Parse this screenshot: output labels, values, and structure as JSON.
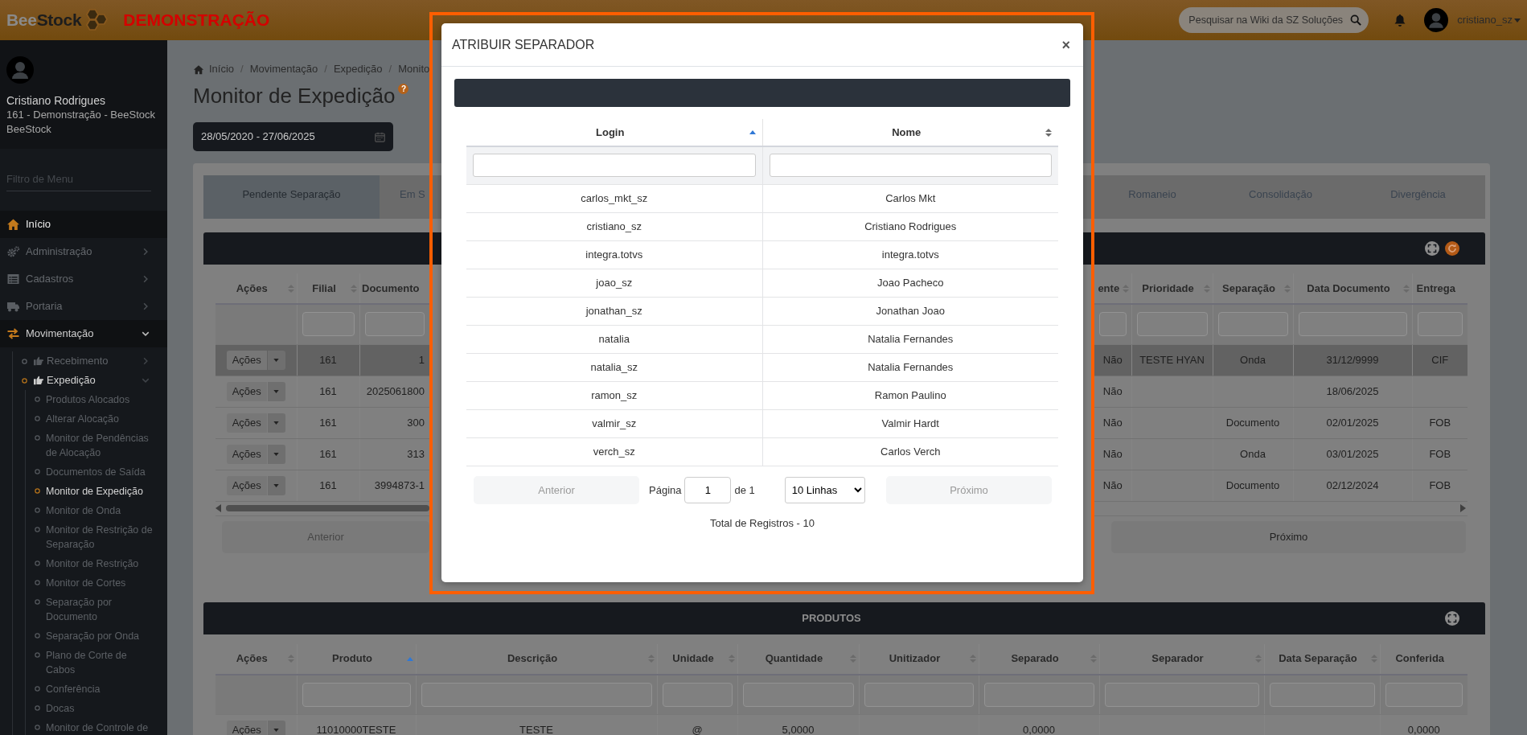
{
  "header": {
    "logo_prefix": "Bee",
    "logo_suffix": "Stock",
    "environment": "DEMONSTRAÇÃO",
    "search": {
      "placeholder": "Pesquisar na Wiki da SZ Soluções"
    },
    "user": "cristiano_sz"
  },
  "sidebar": {
    "profile": {
      "name": "Cristiano Rodrigues",
      "detail": "161 - Demonstração - BeeStock BeeStock"
    },
    "filter": {
      "placeholder": "Filtro de Menu"
    },
    "items": [
      {
        "label": "Início",
        "kind": "home",
        "selected": true
      },
      {
        "label": "Administração",
        "kind": "gears",
        "selected": false,
        "expanded": false
      },
      {
        "label": "Cadastros",
        "kind": "list",
        "selected": false,
        "expanded": false
      },
      {
        "label": "Portaria",
        "kind": "truck",
        "selected": false,
        "expanded": false
      },
      {
        "label": "Movimentação",
        "kind": "arrows",
        "selected": false,
        "expanded": true,
        "children": [
          {
            "label": "Recebimento",
            "selected": false,
            "expanded": false
          },
          {
            "label": "Expedição",
            "selected": true,
            "expanded": true,
            "children": [
              {
                "label": "Produtos Alocados",
                "selected": false
              },
              {
                "label": "Alterar Alocação",
                "selected": false
              },
              {
                "label": "Monitor de Pendências de Alocação",
                "selected": false
              },
              {
                "label": "Documentos de Saída",
                "selected": false
              },
              {
                "label": "Monitor de Expedição",
                "selected": true
              },
              {
                "label": "Monitor de Onda",
                "selected": false
              },
              {
                "label": "Monitor de Restrição de Separação",
                "selected": false
              },
              {
                "label": "Monitor de Restrição",
                "selected": false
              },
              {
                "label": "Monitor de Cortes",
                "selected": false
              },
              {
                "label": "Separação por Documento",
                "selected": false
              },
              {
                "label": "Separação por Onda",
                "selected": false
              },
              {
                "label": "Plano de Corte de Cabos",
                "selected": false
              },
              {
                "label": "Conferência",
                "selected": false
              },
              {
                "label": "Docas",
                "selected": false
              },
              {
                "label": "Monitor de Controle de",
                "selected": false
              }
            ]
          }
        ]
      }
    ]
  },
  "main": {
    "breadcrumb": {
      "items": [
        "Início",
        "Movimentação",
        "Expedição",
        "Monito"
      ],
      "separators": [
        "/",
        "/",
        "/"
      ]
    },
    "title": "Monitor de Expedição",
    "help": "?",
    "date_range": "28/05/2020 - 27/06/2025",
    "tabs": [
      {
        "label": "Pendente Separação",
        "selected": true
      },
      {
        "label": "Em S",
        "selected": false
      },
      {
        "label": "Romaneio",
        "selected": false
      },
      {
        "label": "Consolidação",
        "selected": false
      },
      {
        "label": "Divergência",
        "selected": false
      }
    ],
    "orders": {
      "columns": [
        {
          "label": "Ações",
          "sortable": true,
          "sorted": false,
          "filter": false
        },
        {
          "label": "Filial",
          "sortable": true,
          "sorted": false,
          "filter": true
        },
        {
          "label": "Documento",
          "sortable": false,
          "filter": true
        },
        {
          "label": "ente",
          "sortable": true,
          "sorted": false,
          "filter": true
        },
        {
          "label": "Prioridade",
          "sortable": true,
          "sorted": false,
          "filter": true
        },
        {
          "label": "Separação",
          "sortable": true,
          "sorted": false,
          "filter": true
        },
        {
          "label": "Data Documento",
          "sortable": true,
          "sorted": false,
          "filter": true
        },
        {
          "label": "Entrega",
          "sortable": false,
          "filter": true
        }
      ],
      "rows": [
        {
          "selected": true,
          "cells": [
            "Ações",
            "161",
            "1",
            "Não",
            "TESTE HYAN",
            "Onda",
            "31/12/9999",
            "CIF"
          ]
        },
        {
          "selected": false,
          "cells": [
            "Ações",
            "161",
            "2025061800",
            "Não",
            null,
            null,
            "18/06/2025",
            null
          ]
        },
        {
          "selected": false,
          "cells": [
            "Ações",
            "161",
            "300",
            "Não",
            null,
            "Documento",
            "02/01/2025",
            "FOB"
          ]
        },
        {
          "selected": false,
          "cells": [
            "Ações",
            "161",
            "313",
            "Não",
            null,
            "Onda",
            "03/01/2025",
            "FOB"
          ]
        },
        {
          "selected": false,
          "cells": [
            "Ações",
            "161",
            "3994873-1",
            "Não",
            null,
            "Documento",
            "02/12/2024",
            "FOB"
          ]
        }
      ],
      "previous": {
        "label": "Anterior",
        "disabled": true
      },
      "next": {
        "label": "Próximo",
        "disabled": false
      }
    },
    "products": {
      "title": "PRODUTOS",
      "columns": [
        {
          "label": "Ações",
          "sortable": true,
          "sorted": false,
          "filter": false
        },
        {
          "label": "Produto",
          "sortable": true,
          "sorted": true,
          "filter": true
        },
        {
          "label": "Descrição",
          "sortable": true,
          "sorted": false,
          "filter": true
        },
        {
          "label": "Unidade",
          "sortable": true,
          "sorted": false,
          "filter": true
        },
        {
          "label": "Quantidade",
          "sortable": true,
          "sorted": false,
          "filter": true
        },
        {
          "label": "Unitizador",
          "sortable": true,
          "sorted": false,
          "filter": true
        },
        {
          "label": "Separado",
          "sortable": true,
          "sorted": false,
          "filter": true
        },
        {
          "label": "Separador",
          "sortable": true,
          "sorted": false,
          "filter": true
        },
        {
          "label": "Data Separação",
          "sortable": true,
          "sorted": false,
          "filter": true
        },
        {
          "label": "Conferida",
          "sortable": false,
          "filter": true
        }
      ],
      "rows": [
        {
          "selected": false,
          "cells": [
            "Ações",
            "11010000TESTE",
            "TESTE",
            "@",
            "5,0000",
            null,
            "0,0000",
            null,
            null,
            "0,0000"
          ]
        }
      ]
    }
  },
  "modal": {
    "title": "ATRIBUIR SEPARADOR",
    "close": "×",
    "columns": [
      {
        "label": "Login",
        "sortable": true,
        "sorted": true,
        "filter": true
      },
      {
        "label": "Nome",
        "sortable": true,
        "sorted": false,
        "filter": true
      }
    ],
    "rows": [
      [
        "carlos_mkt_sz",
        "Carlos Mkt"
      ],
      [
        "cristiano_sz",
        "Cristiano Rodrigues"
      ],
      [
        "integra.totvs",
        "integra.totvs"
      ],
      [
        "joao_sz",
        "Joao Pacheco"
      ],
      [
        "jonathan_sz",
        "Jonathan Joao"
      ],
      [
        "natalia",
        "Natalia Fernandes"
      ],
      [
        "natalia_sz",
        "Natalia Fernandes"
      ],
      [
        "ramon_sz",
        "Ramon Paulino"
      ],
      [
        "valmir_sz",
        "Valmir Hardt"
      ],
      [
        "verch_sz",
        "Carlos Verch"
      ]
    ],
    "previous": {
      "label": "Anterior",
      "disabled": true
    },
    "page_label": "Página",
    "page": "1",
    "page_count": "de 1",
    "page_size": "10 Linhas",
    "next": {
      "label": "Próximo",
      "disabled": true
    },
    "total": "Total de Registros - 10"
  }
}
